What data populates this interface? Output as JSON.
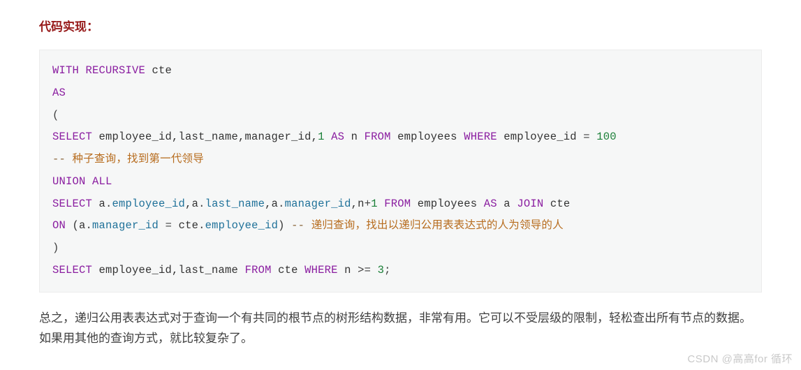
{
  "heading": "代码实现：",
  "code": {
    "line1": {
      "kw1": "WITH",
      "kw2": "RECURSIVE",
      "ident": " cte"
    },
    "line2": {
      "kw": "AS"
    },
    "line3": {
      "punct": "("
    },
    "line4": {
      "kw1": "SELECT",
      "cols": " employee_id,last_name,manager_id,",
      "one": "1",
      "kw2": "AS",
      "alias": " n ",
      "kw3": "FROM",
      "tbl": " employees ",
      "kw4": "WHERE",
      "cond": " employee_id ",
      "eq": "=",
      "num": " 100"
    },
    "line5": {
      "dash": "--",
      "comment": " 种子查询，找到第一代领导"
    },
    "line6": {
      "kw1": "UNION",
      "kw2": " ALL"
    },
    "line7": {
      "kw1": "SELECT",
      "sp1": " a",
      "dot1": ".",
      "f1": "employee_id",
      "c1": ",a",
      "dot2": ".",
      "f2": "last_name",
      "c2": ",a",
      "dot3": ".",
      "f3": "manager_id",
      "c3": ",n",
      "plus": "+",
      "one": "1",
      "sp": " ",
      "kw2": "FROM",
      "tbl": " employees ",
      "kw3": "AS",
      "a": " a ",
      "kw4": "JOIN",
      "cte": " cte"
    },
    "line8": {
      "kw1": "ON",
      "open": " (a",
      "dot1": ".",
      "f1": "manager_id",
      "sp1": " ",
      "eq": "=",
      "sp2": " cte",
      "dot2": ".",
      "f2": "employee_id",
      "close": ") ",
      "dash": "--",
      "comment": " 递归查询，找出以递归公用表表达式的人为领导的人"
    },
    "line9": {
      "punct": ")"
    },
    "line10": {
      "kw1": "SELECT",
      "cols": " employee_id,last_name ",
      "kw2": "FROM",
      "cte": " cte ",
      "kw3": "WHERE",
      "n": " n ",
      "gte": ">=",
      "sp": " ",
      "num": "3",
      "semi": ";"
    }
  },
  "paragraph": "总之，递归公用表表达式对于查询一个有共同的根节点的树形结构数据，非常有用。它可以不受层级的限制，轻松查出所有节点的数据。如果用其他的查询方式，就比较复杂了。",
  "watermark": "CSDN @高高for 循环"
}
